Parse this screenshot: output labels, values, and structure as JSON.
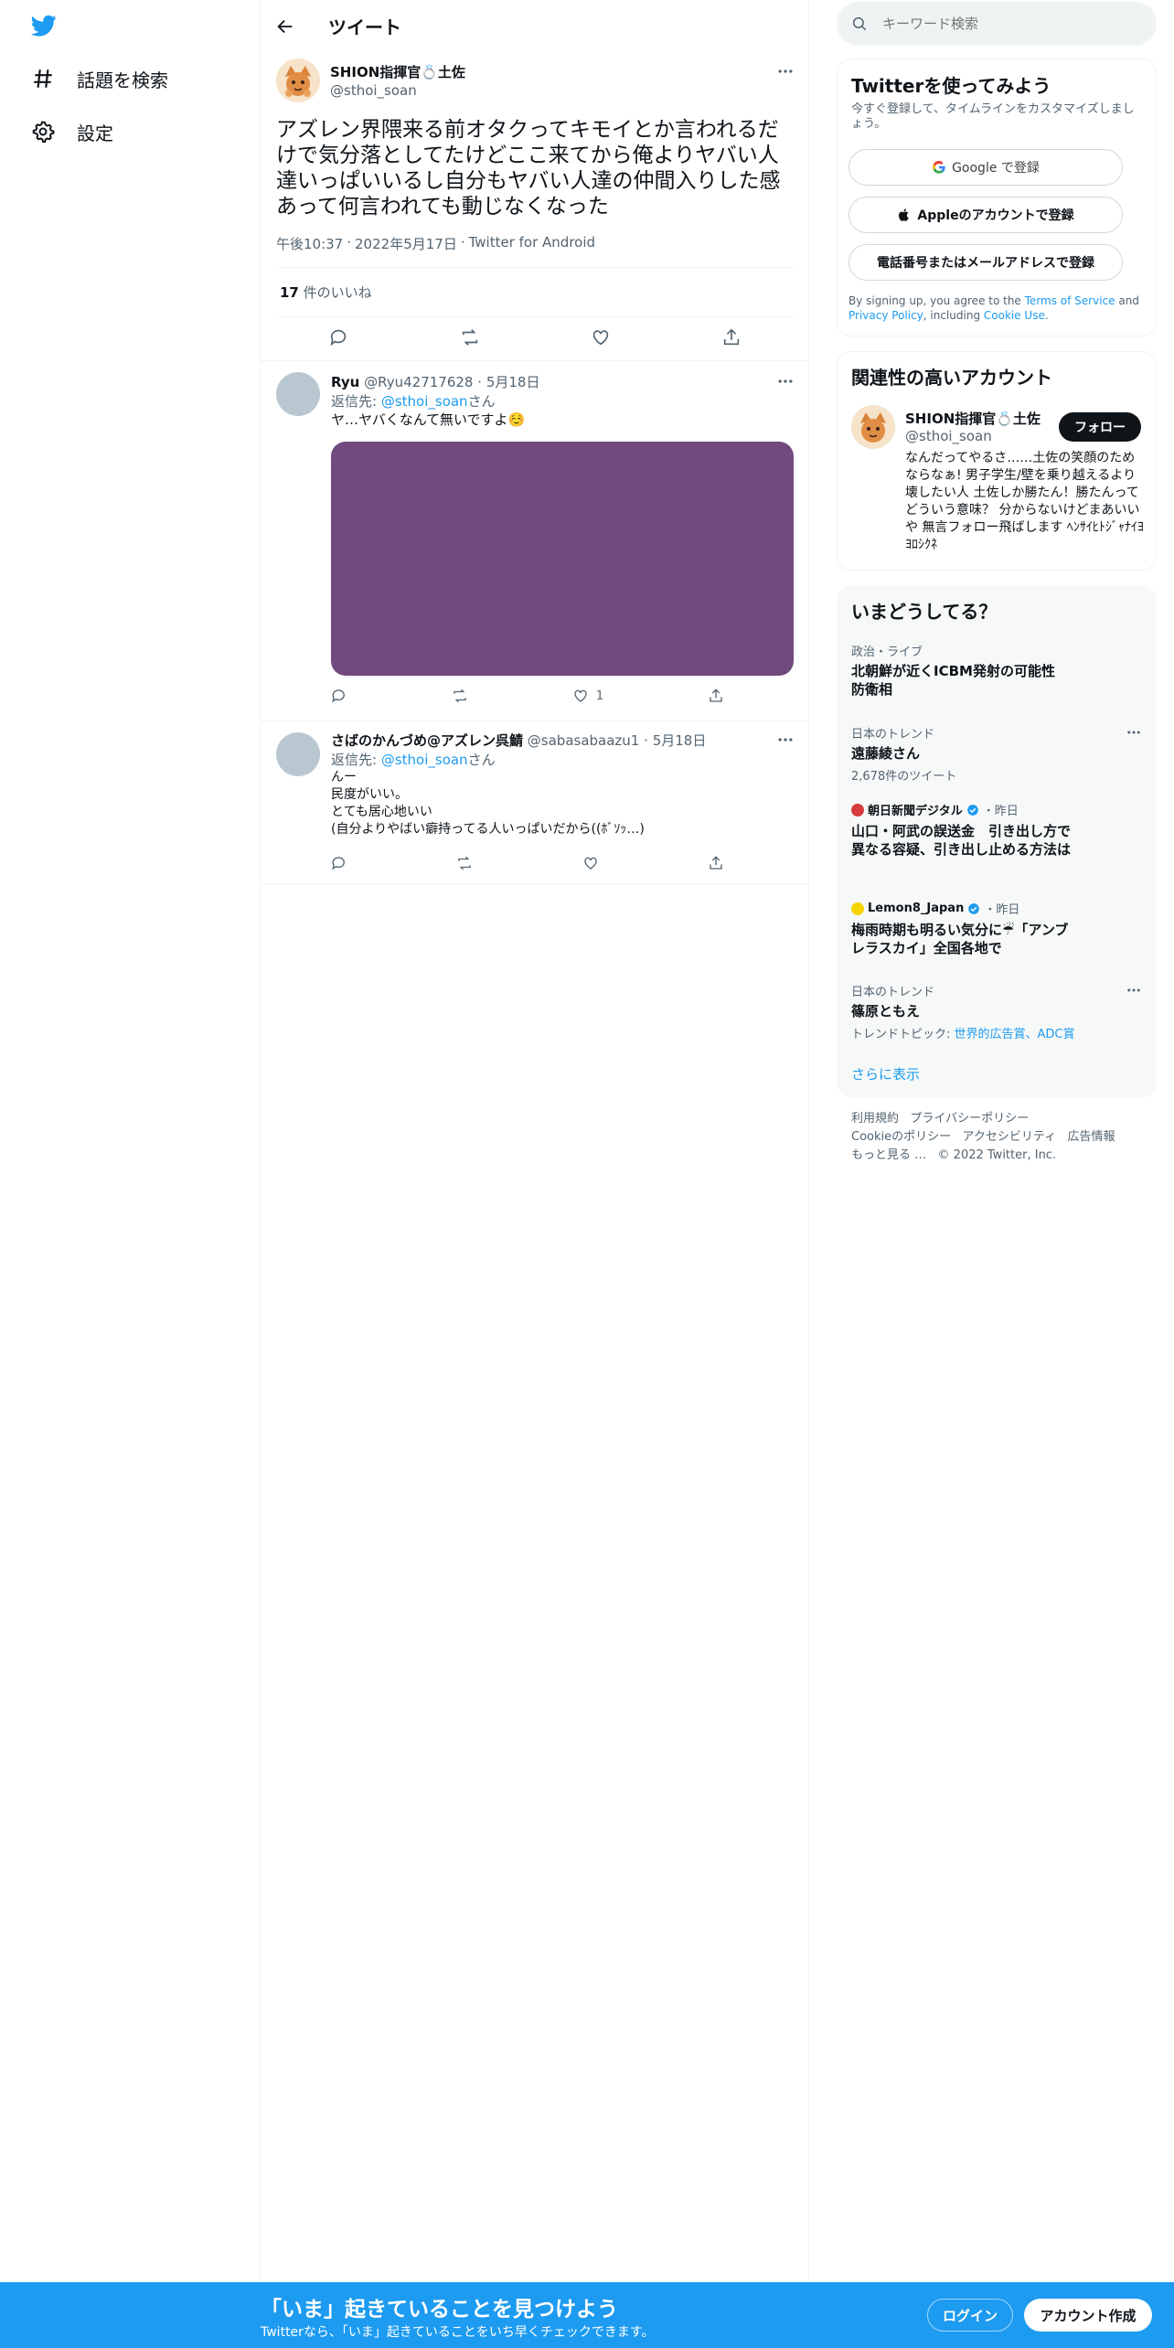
{
  "nav": {
    "items": [
      {
        "label": "話題を検索"
      },
      {
        "label": "設定"
      }
    ]
  },
  "header": {
    "title": "ツイート"
  },
  "tweet": {
    "display_name": "SHION指揮官💍土佐",
    "handle": "@sthoi_soan",
    "text": "アズレン界隈来る前オタクってキモイとか言われるだけで気分落としてたけどここ来てから俺よりヤバい人達いっぱいいるし自分もヤバい人達の仲間入りした感あって何言われても動じなくなった",
    "time": "午後10:37",
    "date": "2022年5月17日",
    "source": "Twitter for Android",
    "likes_count": "17",
    "likes_label": "件のいいね"
  },
  "replies": [
    {
      "name": "Ryu",
      "handle": "@Ryu42717628",
      "date": "5月18日",
      "reply_to_label": "返信先: ",
      "reply_to": "@sthoi_soan",
      "reply_suffix": "さん",
      "text": "ヤ…ヤバくなんて無いですよ☺️",
      "like_count": "1",
      "media_color": "#714b7e"
    },
    {
      "name": "さばのかんづめ@アズレン呉鯖",
      "handle": "@sabasabaazu1",
      "date": "5月18日",
      "reply_to_label": "返信先: ",
      "reply_to": "@sthoi_soan",
      "reply_suffix": "さん",
      "lines": [
        "んー",
        "民度がいい。",
        "とても居心地いい",
        "(自分よりやばい癖持ってる人いっぱいだから((ﾎﾞｿｯ…)"
      ],
      "like_count": ""
    }
  ],
  "search": {
    "placeholder": "キーワード検索"
  },
  "signup": {
    "title": "Twitterを使ってみよう",
    "subtitle": "今すぐ登録して、タイムラインをカスタマイズしましょう。",
    "google": "Google で登録",
    "apple": "Appleのアカウントで登録",
    "phone": "電話番号またはメールアドレスで登録",
    "terms_pre": "By signing up, you agree to the ",
    "terms_link": "Terms of Service",
    "terms_and": " and ",
    "privacy_link": "Privacy Policy",
    "terms_including": ", including ",
    "cookie_link": "Cookie Use",
    "terms_end": "."
  },
  "relevant": {
    "title": "関連性の高いアカウント",
    "name": "SHION指揮官💍土佐",
    "handle": "@sthoi_soan",
    "follow": "フォロー",
    "bio": "なんだってやるさ……土佐の笑顔のためならなぁ! 男子学生/壁を乗り越えるより壊したい人 土佐しか勝たん！勝たんってどういう意味？ 分からないけどまあいいや 無言フォロー飛ばします ﾍﾝｻｲﾋﾄｼﾞｬﾅｲﾖ ﾖﾛｼｸﾈ"
  },
  "trends": {
    "title": "いまどうしてる？",
    "items": [
      {
        "category": "政治・ライブ",
        "title": "北朝鮮が近くICBM発射の可能性　防衛相"
      },
      {
        "category": "日本のトレンド",
        "title": "遠藤綾さん",
        "meta": "2,678件のツイート"
      },
      {
        "source": "朝日新聞デジタル",
        "time": "・昨日",
        "title": "山口・阿武の誤送金　引き出し方で異なる容疑、引き出し止める方法は"
      },
      {
        "source": "Lemon8_Japan",
        "time": "・昨日",
        "title": "梅雨時期も明るい気分に☔「アンブレラスカイ」全国各地で"
      },
      {
        "category": "日本のトレンド",
        "title": "篠原ともえ",
        "meta_label": "トレンドトピック: ",
        "meta_link": "世界的広告賞、ADC賞"
      }
    ],
    "show_more": "さらに表示"
  },
  "footer": {
    "links": [
      "利用規約",
      "プライバシーポリシー",
      "Cookieのポリシー",
      "アクセシビリティ",
      "広告情報",
      "もっと見る …"
    ],
    "copyright": "© 2022 Twitter, Inc."
  },
  "bottom": {
    "title": "「いま」起きていることを見つけよう",
    "subtitle": "Twitterなら、「いま」起きていることをいち早くチェックできます。",
    "login": "ログイン",
    "signup": "アカウント作成"
  },
  "colors": {
    "accent": "#1d9bf0",
    "text": "#0f1419",
    "muted": "#536471",
    "border": "#eff3f4"
  }
}
